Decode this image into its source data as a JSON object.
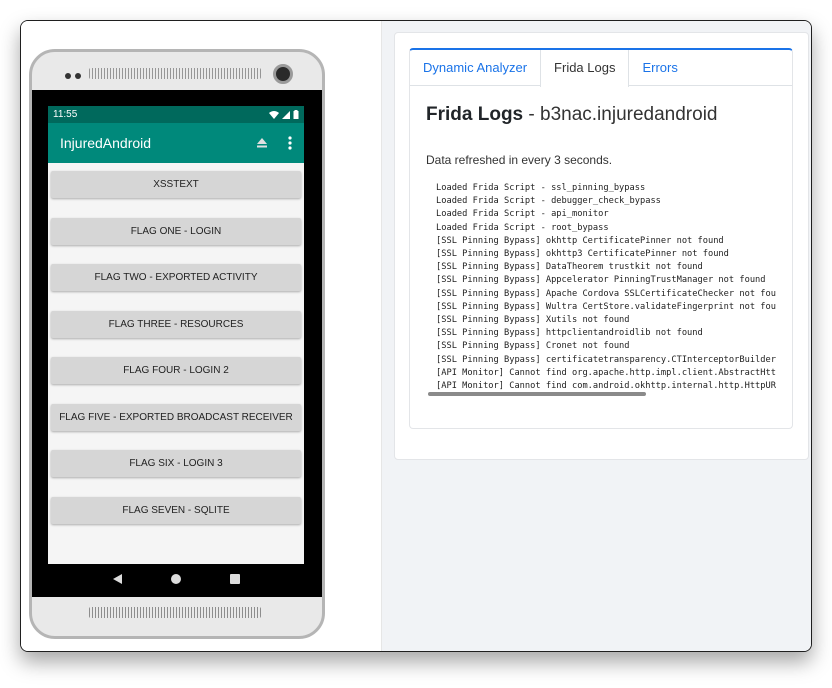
{
  "phone": {
    "status_time": "11:55",
    "app_title": "InjuredAndroid",
    "buttons": [
      "XSSTEXT",
      "FLAG ONE - LOGIN",
      "FLAG TWO - EXPORTED ACTIVITY",
      "FLAG THREE - RESOURCES",
      "FLAG FOUR - LOGIN 2",
      "FLAG FIVE - EXPORTED BROADCAST RECEIVER",
      "FLAG SIX - LOGIN 3",
      "FLAG SEVEN - SQLITE"
    ],
    "colors": {
      "statusbar": "#00695c",
      "appbar": "#00897b"
    }
  },
  "analyzer": {
    "tabs": [
      "Dynamic Analyzer",
      "Frida Logs",
      "Errors"
    ],
    "active_tab": "Frida Logs",
    "title_bold": "Frida Logs",
    "title_rest": " - b3nac.injuredandroid",
    "refresh_note": "Data refreshed in every 3 seconds.",
    "log_lines": [
      "Loaded Frida Script - ssl_pinning_bypass",
      "Loaded Frida Script - debugger_check_bypass",
      "Loaded Frida Script - api_monitor",
      "Loaded Frida Script - root_bypass",
      "[SSL Pinning Bypass] okhttp CertificatePinner not found",
      "[SSL Pinning Bypass] okhttp3 CertificatePinner not found",
      "[SSL Pinning Bypass] DataTheorem trustkit not found",
      "[SSL Pinning Bypass] Appcelerator PinningTrustManager not found",
      "[SSL Pinning Bypass] Apache Cordova SSLCertificateChecker not fou",
      "[SSL Pinning Bypass] Wultra CertStore.validateFingerprint not fou",
      "[SSL Pinning Bypass] Xutils not found",
      "[SSL Pinning Bypass] httpclientandroidlib not found",
      "[SSL Pinning Bypass] Cronet not found",
      "[SSL Pinning Bypass] certificatetransparency.CTInterceptorBuilder",
      "[API Monitor] Cannot find org.apache.http.impl.client.AbstractHtt",
      "[API Monitor] Cannot find com.android.okhttp.internal.http.HttpUR"
    ],
    "accent_color": "#1a73e8"
  }
}
